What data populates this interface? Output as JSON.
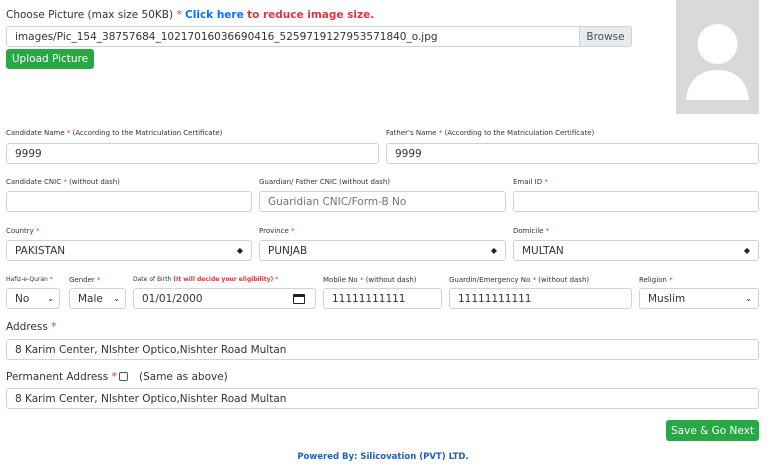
{
  "picture": {
    "label": "Choose Picture (max size 50KB)",
    "required_mark": "*",
    "link_text": "Click here",
    "link_suffix": "to reduce image size.",
    "file_value": "images/Pic_154_38757684_10217016036690416_5259719127953571840_o.jpg",
    "browse_label": "Browse",
    "upload_label": "Upload Picture"
  },
  "candidate_name": {
    "label": "Candidate Name",
    "mark": "*",
    "hint": "(According to the Matriculation Certificate)",
    "value": "9999"
  },
  "father_name": {
    "label": "Father's Name",
    "mark": "*",
    "hint": "(According to the Matriculation Certificate)",
    "value": "9999"
  },
  "candidate_cnic": {
    "label": "Candidate CNIC",
    "mark": "*",
    "hint": "(without dash)",
    "value": ""
  },
  "guardian_cnic": {
    "label": "Guardian/ Father CNIC (without dash)",
    "placeholder": "Guaridian CNIC/Form-B No"
  },
  "email": {
    "label": "Email ID",
    "mark": "*",
    "value": ""
  },
  "country": {
    "label": "Country",
    "mark": "*",
    "value": "PAKISTAN"
  },
  "province": {
    "label": "Province",
    "mark": "*",
    "value": "PUNJAB"
  },
  "domicile": {
    "label": "Domicile",
    "mark": "*",
    "value": "MULTAN"
  },
  "hafiz": {
    "label": "Hafiz-e-Quran",
    "mark": "*",
    "value": "No"
  },
  "gender": {
    "label": "Gender",
    "mark": "*",
    "value": "Male"
  },
  "dob": {
    "label": "Date of Birth",
    "hint": "(It will decide your eligibility)",
    "mark": "*",
    "value": "01/01/2000"
  },
  "mobile": {
    "label": "Mobile No",
    "mark": "*",
    "hint": "(without dash)",
    "value": "11111111111"
  },
  "guardian_mobile": {
    "label": "Guardin/Emergency No",
    "mark": "*",
    "hint": "(without dash)",
    "value": "11111111111"
  },
  "religion": {
    "label": "Religion",
    "mark": "*",
    "value": "Muslim"
  },
  "address": {
    "label": "Address",
    "mark": "*",
    "value": "8 Karim Center, NIshter Optico,Nishter Road Multan"
  },
  "permanent_address": {
    "label": "Permanent Address",
    "mark": "*",
    "same_label": "(Same as above)",
    "value": "8 Karim Center, NIshter Optico,Nishter Road Multan"
  },
  "save_label": "Save & Go Next",
  "footer": "Powered By: Silicovation (PVT) LTD.",
  "colors": {
    "green": "#28a745",
    "link": "#0d6efd",
    "required": "#dc3545",
    "footer": "#1f5fbf"
  }
}
